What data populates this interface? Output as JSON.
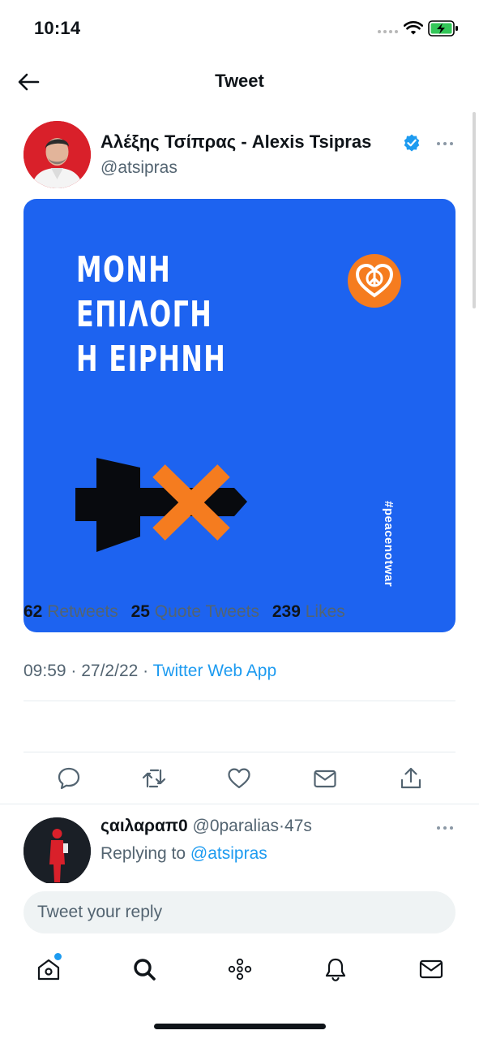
{
  "status_bar": {
    "time": "10:14"
  },
  "header": {
    "title": "Tweet"
  },
  "tweet": {
    "author_name": "Αλέξης Τσίπρας - Alexis Tsipras",
    "author_handle": "@atsipras",
    "media": {
      "headline_lines": [
        "ΜΟΝΗ",
        "ΕΠΙΛΟΓΗ",
        "Η ΕΙΡΗΝΗ"
      ],
      "hashtag": "#peacenotwar",
      "background_color": "#1d63f0",
      "accent_color": "#f57c1f"
    },
    "time": "09:59",
    "date": "27/2/22",
    "source": "Twitter Web App",
    "stats": {
      "retweets_count": "62",
      "retweets_label": "Retweets",
      "quotes_count": "25",
      "quotes_label": "Quote Tweets",
      "likes_count": "239",
      "likes_label": "Likes"
    },
    "actions": [
      "reply-icon",
      "retweet-icon",
      "like-icon",
      "dm-icon",
      "share-icon"
    ]
  },
  "reply": {
    "name": "ςαιλαραπ0",
    "handle": "@0paralias",
    "time": "47s",
    "replying_label": "Replying to",
    "replying_to": "@atsipras"
  },
  "compose": {
    "placeholder": "Tweet your reply"
  },
  "tab_bar": [
    "home-icon",
    "search-icon",
    "spaces-icon",
    "notifications-icon",
    "messages-icon"
  ],
  "colors": {
    "accent": "#1d9bf0",
    "text": "#0f1419",
    "secondary": "#536471"
  }
}
